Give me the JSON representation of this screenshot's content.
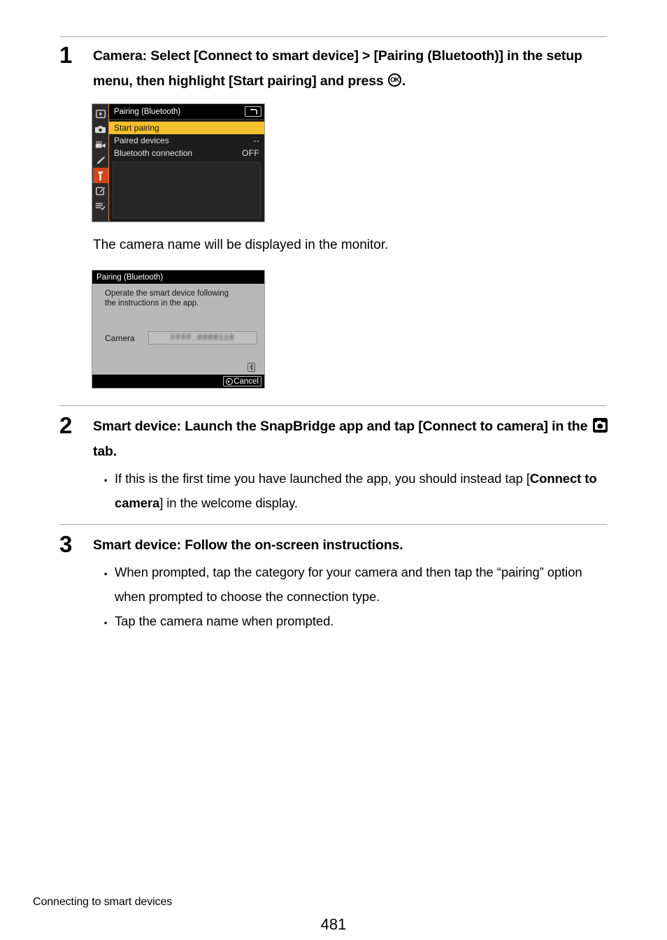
{
  "page": {
    "number": "481",
    "footer_label": "Connecting to smart devices"
  },
  "steps": [
    {
      "number": "1",
      "heading_part_1": "Camera: Select [Connect to smart device] > [Pairing (Bluetooth)] in the setup menu, then highlight [Start pairing] and press ",
      "heading_icon": "ok-button-icon",
      "heading_part_2": "."
    },
    {
      "number": "2",
      "heading_part_1": "Smart device: Launch the SnapBridge app and tap [Connect to camera] in the ",
      "heading_icon": "camera-tab-icon",
      "heading_part_2": " tab.",
      "bullets": [
        {
          "text_before": "If this is the first time you have launched the app, you should instead tap [",
          "bold": "Connect to camera",
          "text_after": "] in the welcome display."
        }
      ]
    },
    {
      "number": "3",
      "heading": "Smart device: Follow the on-screen instructions.",
      "bullets": [
        {
          "text": "When prompted, tap the category for your camera and then tap the “pairing” option when prompted to choose the connection type."
        },
        {
          "text": "Tap the camera name when prompted."
        }
      ]
    }
  ],
  "caption": "The camera name will be displayed in the monitor.",
  "camera_menu": {
    "title": "Pairing (Bluetooth)",
    "return_icon": "return-arrow-icon",
    "sidebar_icons": [
      "playback-icon",
      "photo-shooting-icon",
      "movie-shooting-icon",
      "custom-settings-pencil-icon",
      "setup-wrench-icon",
      "retouch-icon",
      "recent-settings-icon"
    ],
    "active_sidebar_index": 4,
    "rows": [
      {
        "label": "Start pairing",
        "value": "",
        "selected": true
      },
      {
        "label": "Paired devices",
        "value": "--",
        "selected": false
      },
      {
        "label": "Bluetooth connection",
        "value": "OFF",
        "selected": false
      }
    ],
    "colors": {
      "highlight": "#f3c02c",
      "active_tab": "#cf4718",
      "background": "#1d1d1d"
    }
  },
  "camera_dialog": {
    "title": "Pairing (Bluetooth)",
    "message_line_1": "Operate the smart device following",
    "message_line_2": "the instructions in the app.",
    "field_label": "Camera",
    "field_value_redacted": "FFFF_0808118",
    "bluetooth_icon": "bluetooth-icon",
    "cancel_label": "Cancel",
    "cancel_icon": "menu-button-icon",
    "colors": {
      "body": "#b8b8b8"
    }
  }
}
